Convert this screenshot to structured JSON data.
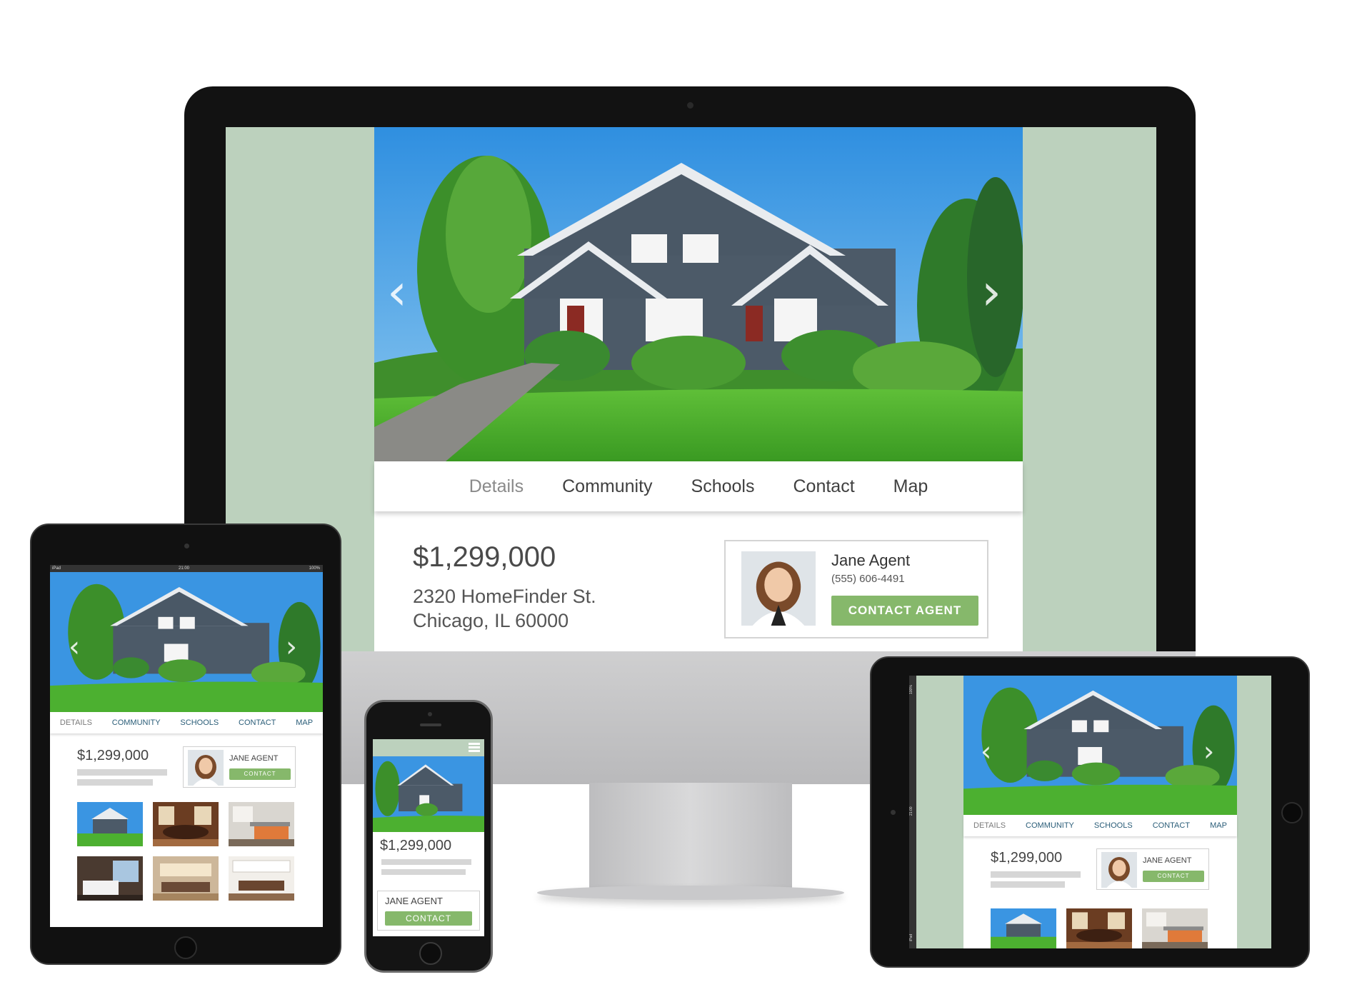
{
  "listing": {
    "price": "$1,299,000",
    "address_line1": "2320 HomeFinder St.",
    "address_line2": "Chicago, IL 60000"
  },
  "tabs_desktop": [
    "Details",
    "Community",
    "Schools",
    "Contact",
    "Map"
  ],
  "tabs_small": [
    "DETAILS",
    "COMMUNITY",
    "SCHOOLS",
    "CONTACT",
    "MAP"
  ],
  "agent": {
    "name": "Jane Agent",
    "phone": "(555) 606-4491",
    "name_small": "JANE AGENT",
    "contact_button": "CONTACT AGENT",
    "contact_button_small": "CONTACT",
    "contact_button_phone": "CONTACT"
  },
  "ipad_status": {
    "carrier": "iPad",
    "time": "21:00",
    "battery": "100%"
  },
  "ipad_landscape_status": {
    "battery": "100%",
    "time": "21:00",
    "carrier": "iPad"
  },
  "icons": {
    "prev": "chevron-left-icon",
    "next": "chevron-right-icon",
    "menu": "hamburger-menu-icon"
  },
  "colors": {
    "page_background": "#bcd1bd",
    "button_green": "#86b86b",
    "tab_text_small": "#2a5d78"
  }
}
